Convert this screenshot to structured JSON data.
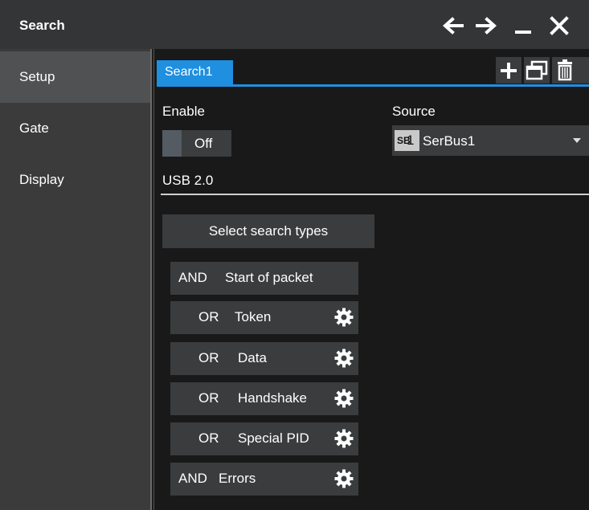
{
  "window": {
    "title": "Search"
  },
  "sidebar": {
    "items": [
      {
        "label": "Setup"
      },
      {
        "label": "Gate"
      },
      {
        "label": "Display"
      }
    ]
  },
  "tabs": {
    "items": [
      {
        "label": "Search1"
      }
    ]
  },
  "enable": {
    "label": "Enable",
    "state": "Off"
  },
  "source": {
    "label": "Source",
    "badge_prefix": "SB",
    "badge_index": "1",
    "value": "SerBus1"
  },
  "protocol": {
    "label": "USB 2.0"
  },
  "search_types": {
    "button_label": "Select search types",
    "conditions": [
      {
        "op": "AND",
        "name": "Start of packet"
      },
      {
        "op": "OR",
        "name": "Token"
      },
      {
        "op": "OR",
        "name": "Data"
      },
      {
        "op": "OR",
        "name": "Handshake"
      },
      {
        "op": "OR",
        "name": "Special PID"
      },
      {
        "op": "AND",
        "name": "Errors"
      }
    ]
  },
  "colors": {
    "accent": "#1f8fe0",
    "panel": "#3a3c3d",
    "sidebar": "#3b3b3b",
    "background": "#191919"
  }
}
